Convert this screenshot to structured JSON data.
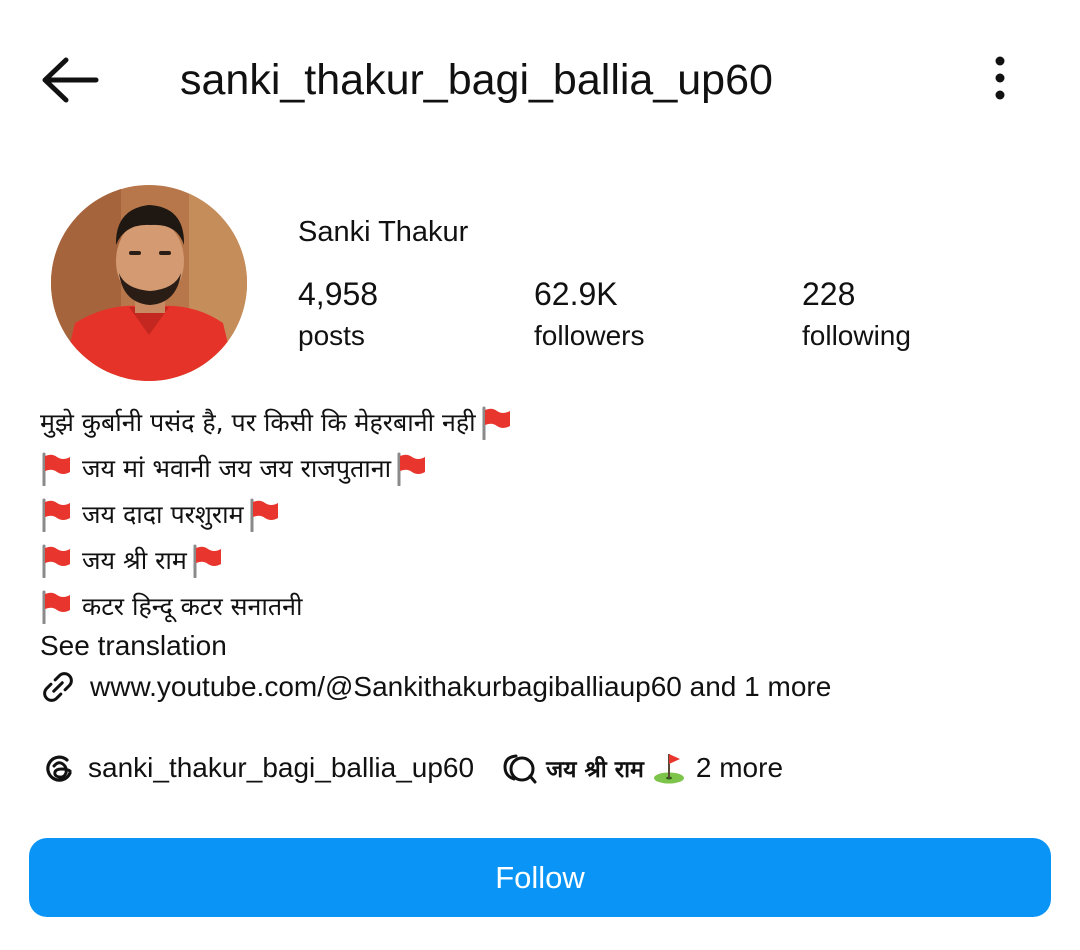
{
  "header": {
    "username": "sanki_thakur_bagi_ballia_up60",
    "back_icon": "arrow-left-icon",
    "more_icon": "vertical-dots-icon"
  },
  "profile": {
    "display_name": "Sanki Thakur",
    "stats": {
      "posts": {
        "value": "4,958",
        "label": "posts"
      },
      "followers": {
        "value": "62.9K",
        "label": "followers"
      },
      "following": {
        "value": "228",
        "label": "following"
      }
    }
  },
  "bio": {
    "line1": "मुझे कुर्बानी पसंद है, पर किसी कि मेहरबानी नही",
    "line2": "जय मां भवानी जय जय राजपुताना",
    "line3": "जय दादा परशुराम",
    "line4": "जय श्री राम",
    "line5": "कटर हिन्दू कटर सनातनी",
    "emoji_icon": "red-flag-icon",
    "see_translation": "See translation"
  },
  "link": {
    "icon": "link-icon",
    "text": "www.youtube.com/@Sankithakurbagiballiaup60 and 1 more"
  },
  "threads": {
    "icon": "threads-icon",
    "username": "sanki_thakur_bagi_ballia_up60"
  },
  "cues": {
    "icon": "chat-bubble-icon",
    "text": "जय श्री राम",
    "emoji_icon": "golf-flag-icon",
    "more": "2 more"
  },
  "actions": {
    "follow_label": "Follow"
  },
  "colors": {
    "accent": "#0a95f6",
    "flag_red": "#e8352d",
    "avatar_shirt": "#e63329"
  }
}
